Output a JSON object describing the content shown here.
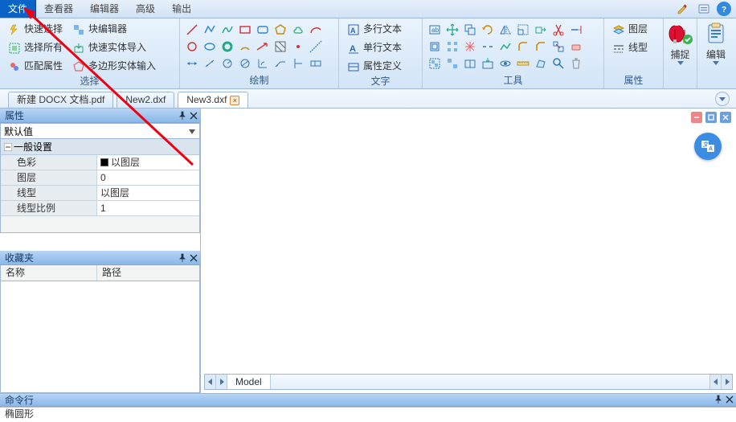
{
  "menu": {
    "items": [
      "文件",
      "查看器",
      "编辑器",
      "高级",
      "输出"
    ],
    "active_index": 0
  },
  "ribbon": {
    "select": {
      "label": "选择",
      "quick_select": "快速选择",
      "select_all": "选择所有",
      "match_prop": "匹配属性",
      "block_editor": "块编辑器",
      "quick_import": "快速实体导入",
      "poly_input": "多边形实体输入"
    },
    "draw": {
      "label": "绘制"
    },
    "text": {
      "label": "文字",
      "mtext": "多行文本",
      "stext": "单行文本",
      "attr_def": "属性定义"
    },
    "tools": {
      "label": "工具"
    },
    "props": {
      "label": "属性",
      "layer": "图层",
      "linetype": "线型"
    },
    "snap": {
      "label": "捕捉"
    },
    "edit": {
      "label": "编辑"
    }
  },
  "tabs": {
    "items": [
      "新建 DOCX 文档.pdf",
      "New2.dxf",
      "New3.dxf"
    ],
    "active_index": 2
  },
  "panels": {
    "props_title": "属性",
    "default_value": "默认值",
    "section_general": "一般设置",
    "rows": {
      "color_k": "色彩",
      "color_v": "以图层",
      "layer_k": "图层",
      "layer_v": "0",
      "ltype_k": "线型",
      "ltype_v": "以图层",
      "lscale_k": "线型比例",
      "lscale_v": "1"
    },
    "fav_title": "收藏夹",
    "fav_col1": "名称",
    "fav_col2": "路径"
  },
  "model_tab": "Model",
  "cmd_title": "命令行",
  "status": "椭圆形"
}
